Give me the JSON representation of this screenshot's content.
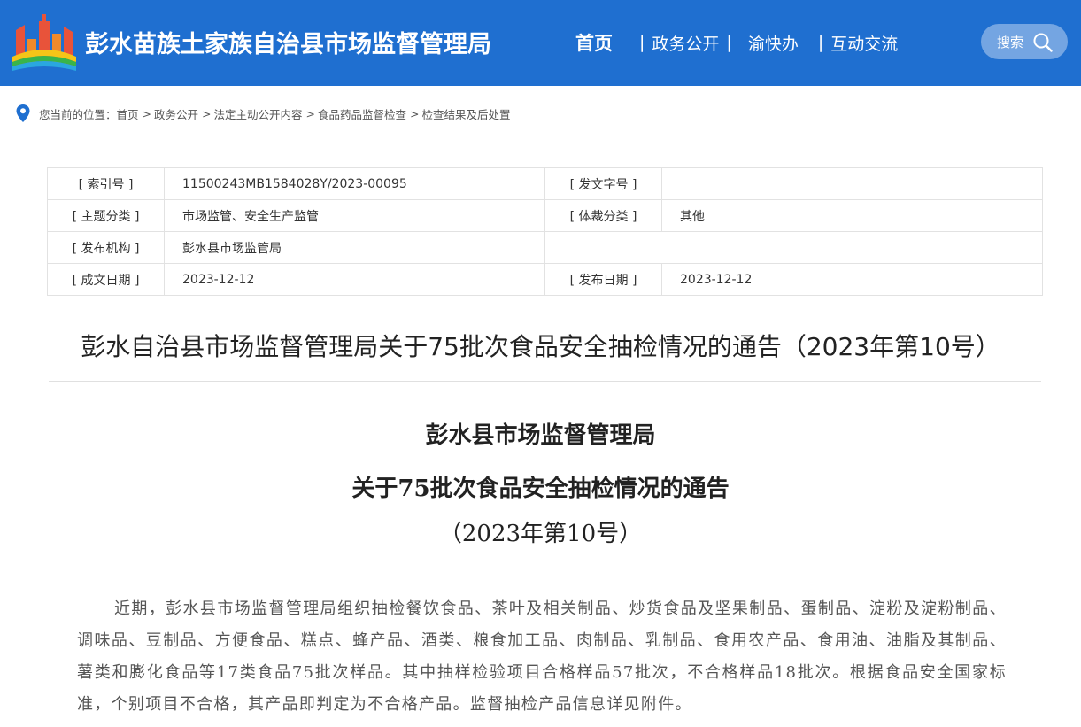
{
  "header": {
    "site_title": "彭水苗族土家族自治县市场监督管理局",
    "nav": {
      "home": "首页",
      "gov_open": "政务公开",
      "yukuaiban": "渝快办",
      "interaction": "互动交流",
      "separator": "|"
    },
    "search_label": "搜索",
    "colors": {
      "background": "#1f6fd0",
      "text": "#ffffff"
    }
  },
  "breadcrumb": {
    "prefix": "您当前的位置：",
    "items": [
      "首页",
      "政务公开",
      "法定主动公开内容",
      "食品药品监督检查",
      "检查结果及后处置"
    ],
    "separator": ">"
  },
  "info": {
    "index_label": "[ 索引号 ]",
    "index_value": "11500243MB1584028Y/2023-00095",
    "doc_no_label": "[ 发文字号 ]",
    "doc_no_value": "",
    "topic_label": "[ 主题分类 ]",
    "topic_value": "市场监管、安全生产监管",
    "genre_label": "[ 体裁分类 ]",
    "genre_value": "其他",
    "publisher_label": "[ 发布机构 ]",
    "publisher_value": "彭水县市场监管局",
    "created_label": "[ 成文日期 ]",
    "created_value": "2023-12-12",
    "published_label": "[ 发布日期 ]",
    "published_value": "2023-12-12"
  },
  "article": {
    "title": "彭水自治县市场监督管理局关于75批次食品安全抽检情况的通告（2023年第10号）",
    "doc_line1": "彭水县市场监督管理局",
    "doc_line2": "关于75批次食品安全抽检情况的通告",
    "doc_line3": "（2023年第10号）",
    "paragraph": "近期，彭水县市场监督管理局组织抽检餐饮食品、茶叶及相关制品、炒货食品及坚果制品、蛋制品、淀粉及淀粉制品、调味品、豆制品、方便食品、糕点、蜂产品、酒类、粮食加工品、肉制品、乳制品、食用农产品、食用油、油脂及其制品、薯类和膨化食品等17类食品75批次样品。其中抽样检验项目合格样品57批次，不合格样品18批次。根据食品安全国家标准，个别项目不合格，其产品即判定为不合格产品。监督抽检产品信息详见附件。"
  },
  "icons": {
    "logo": "county-logo-icon",
    "search": "search-icon",
    "location": "location-pin-icon"
  }
}
